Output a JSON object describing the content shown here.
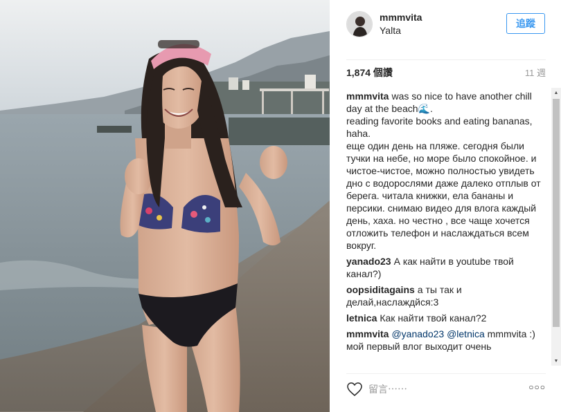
{
  "post": {
    "username": "mmmvita",
    "location": "Yalta",
    "follow_label": "追蹤",
    "likes": "1,874 個讚",
    "time": "11 週"
  },
  "comments": [
    {
      "author": "mmmvita",
      "text": "was so nice to have another chill day at the beach🌊.\nreading favorite books and eating bananas, haha.\nеще один день на пляже. сегодня были тучки на небе, но море было спокойное. и чистое-чистое, можно полностью увидеть дно с водорослями даже далеко отплыв от берега. читала книжки, ела бананы и персики. снимаю видео для влога каждый день, хаха. но честно , все чаще хочется отложить телефон и наслаждаться всем вокруг."
    },
    {
      "author": "yanado23",
      "text": "А как найти в youtube твой канал?)"
    },
    {
      "author": "oopsiditagains",
      "text": "а ты так и делай,наслаждйся:3"
    },
    {
      "author": "letnica",
      "text": "Как найти твой канал?2"
    },
    {
      "author": "mmmvita",
      "mention1": "@yanado23",
      "mention2": "@letnica",
      "text_after": "mmmvita :) мой первый влог выходит очень"
    }
  ],
  "footer": {
    "comment_placeholder": "留言⋯⋯",
    "more_label": "○○○"
  },
  "icons": {
    "like": "heart-icon",
    "more": "more-options-icon"
  }
}
